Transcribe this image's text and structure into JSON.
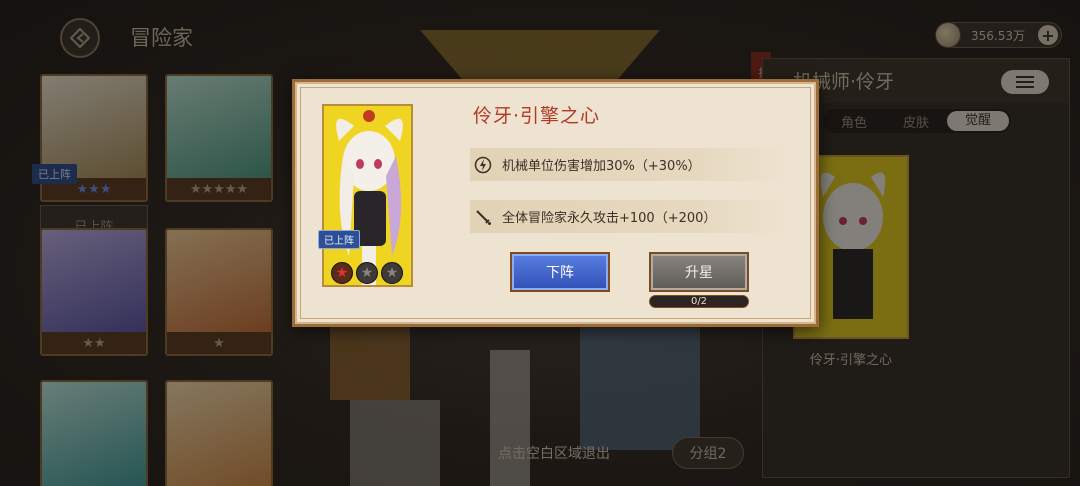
{
  "header": {
    "title": "冒险家",
    "currency_value": "356.53万",
    "plus_label": "+"
  },
  "left_grid": {
    "on_team_tag": "已上阵",
    "on_team_button": "已上阵",
    "cards": [
      {
        "stars": "★★★"
      },
      {
        "stars": "★★★★★"
      },
      {
        "stars": "★★"
      },
      {
        "stars": "★"
      },
      {
        "stars": ""
      },
      {
        "stars": ""
      }
    ]
  },
  "right_panel": {
    "title": "机械师·伶牙",
    "tabs": [
      "角色",
      "皮肤",
      "觉醒"
    ],
    "active_tab": "觉醒",
    "card_caption": "伶牙·引擎之心",
    "menu_icon": "list-icon"
  },
  "dialog": {
    "title": "伶牙·引擎之心",
    "card_tag": "已上阵",
    "card_stars_on": 1,
    "card_stars_total": 3,
    "attributes": [
      {
        "icon": "gear-spin-icon",
        "text": "机械单位伤害增加30%（+30%）"
      },
      {
        "icon": "sword-icon",
        "text": "全体冒险家永久攻击+100（+200）"
      }
    ],
    "buttons": {
      "down": "下阵",
      "upgrade": "升星"
    },
    "progress": {
      "current": 0,
      "max": 2,
      "label": "0/2"
    }
  },
  "footer": {
    "exit_hint": "点击空白区域退出",
    "group_button": "分组2"
  },
  "colors": {
    "accent_red": "#b23a25",
    "button_blue": "#2f4fb6",
    "frame_brown": "#9c6b3a",
    "card_yellow": "#f0d422"
  }
}
